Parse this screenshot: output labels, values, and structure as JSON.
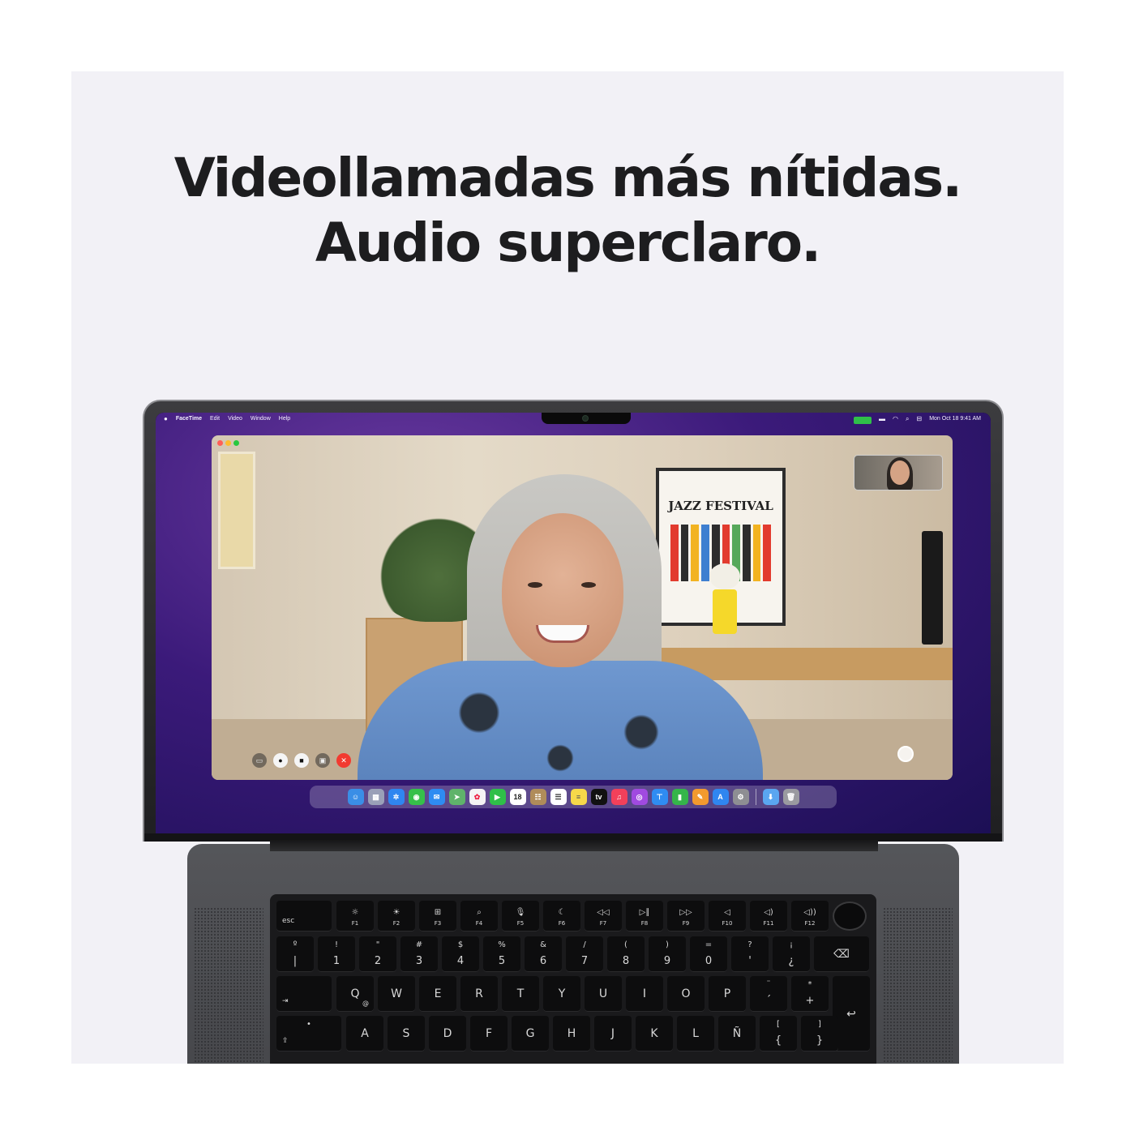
{
  "headline": {
    "line1": "Videollamadas más nítidas.",
    "line2": "Audio superclaro."
  },
  "menubar": {
    "apple_icon": "apple-icon",
    "app_name": "FaceTime",
    "items": [
      "Edit",
      "Video",
      "Window",
      "Help"
    ],
    "status": {
      "facetime_indicator_color": "#2fbf49",
      "date_time": "Mon Oct 18  9:41 AM"
    }
  },
  "facetime": {
    "poster_text": "JAZZ FESTIVAL",
    "controls": [
      "sidebar-icon",
      "microphone-icon",
      "camera-icon",
      "screen-share-icon",
      "end-call-icon"
    ]
  },
  "dock": {
    "calendar_day": "18",
    "tv_label": "tv",
    "apps": [
      "finder-icon",
      "launchpad-icon",
      "safari-icon",
      "messages-icon",
      "mail-icon",
      "maps-icon",
      "photos-icon",
      "facetime-icon",
      "calendar-icon",
      "notes-icon",
      "reminders-icon",
      "notes-yellow-icon",
      "appletv-icon",
      "music-icon",
      "podcasts-icon",
      "keynote-icon",
      "numbers-icon",
      "pages-icon",
      "appstore-icon",
      "settings-icon",
      "downloads-icon",
      "trash-icon"
    ]
  },
  "keyboard": {
    "esc": "esc",
    "function_keys": [
      {
        "icon": "☼",
        "label": "F1"
      },
      {
        "icon": "☀",
        "label": "F2"
      },
      {
        "icon": "⊞",
        "label": "F3"
      },
      {
        "icon": "⌕",
        "label": "F4"
      },
      {
        "icon": "🎙",
        "label": "F5"
      },
      {
        "icon": "☾",
        "label": "F6"
      },
      {
        "icon": "◁◁",
        "label": "F7"
      },
      {
        "icon": "▷∥",
        "label": "F8"
      },
      {
        "icon": "▷▷",
        "label": "F9"
      },
      {
        "icon": "◁",
        "label": "F10"
      },
      {
        "icon": "◁)",
        "label": "F11"
      },
      {
        "icon": "◁))",
        "label": "F12"
      }
    ],
    "number_row": [
      {
        "top": "º",
        "bot": "|"
      },
      {
        "top": "!",
        "bot": "1"
      },
      {
        "top": "\"",
        "bot": "2"
      },
      {
        "top": "#",
        "bot": "3"
      },
      {
        "top": "$",
        "bot": "4"
      },
      {
        "top": "%",
        "bot": "5"
      },
      {
        "top": "&",
        "bot": "6"
      },
      {
        "top": "/",
        "bot": "7"
      },
      {
        "top": "(",
        "bot": "8"
      },
      {
        "top": ")",
        "bot": "9"
      },
      {
        "top": "=",
        "bot": "0"
      },
      {
        "top": "?",
        "bot": "'"
      },
      {
        "top": "¡",
        "bot": "¿"
      }
    ],
    "delete": "⌫",
    "tab": "⇥",
    "qwerty_row": [
      "Q",
      "W",
      "E",
      "R",
      "T",
      "Y",
      "U",
      "I",
      "O",
      "P"
    ],
    "q_sub": "@",
    "qwerty_extra": [
      {
        "top": "¨",
        "bot": "´"
      },
      {
        "top": "*",
        "bot": "+"
      }
    ],
    "return": "↩",
    "caps": "⇪",
    "caps_dot": "•",
    "asdf_row": [
      "A",
      "S",
      "D",
      "F",
      "G",
      "H",
      "J",
      "K",
      "L",
      "Ñ"
    ],
    "asdf_extra": [
      {
        "top": "[",
        "bot": "{"
      },
      {
        "top": "]",
        "bot": "}"
      }
    ]
  }
}
